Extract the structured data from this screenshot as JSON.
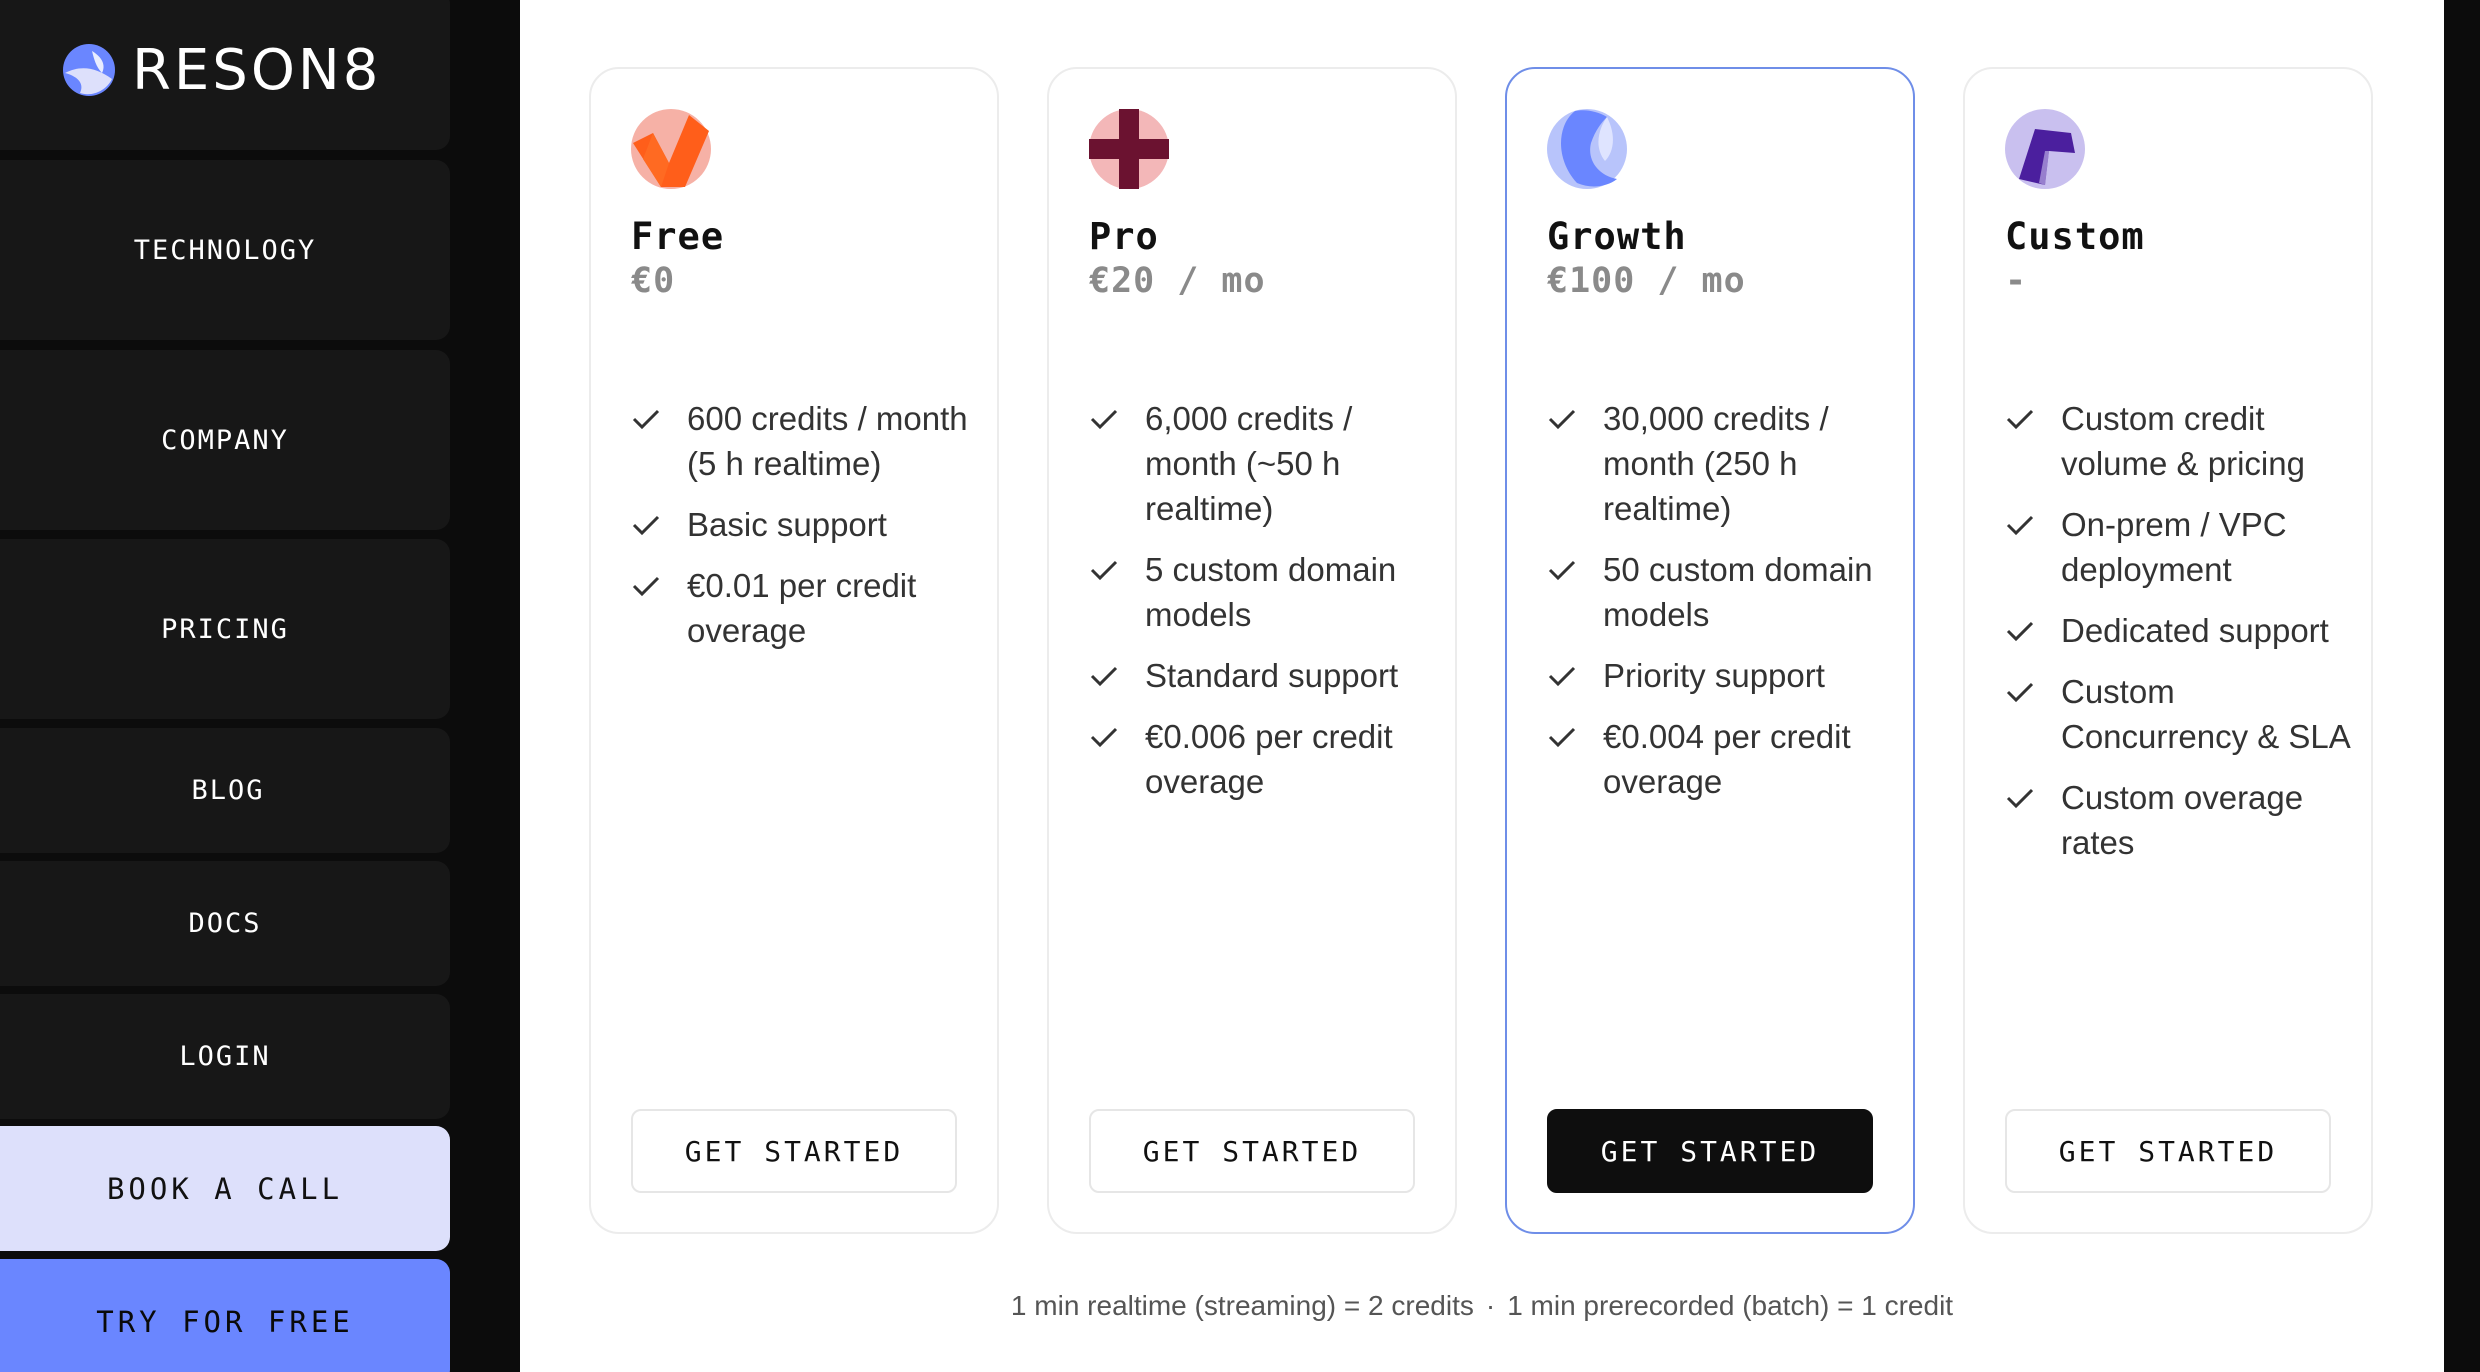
{
  "brand": {
    "name": "RESON8"
  },
  "nav": {
    "technology": "TECHNOLOGY",
    "company": "COMPANY",
    "pricing": "PRICING",
    "blog": "BLOG",
    "docs": "DOCS",
    "login": "LOGIN"
  },
  "cta": {
    "book_call": "BOOK A CALL",
    "try_free": "TRY FOR FREE"
  },
  "colors": {
    "accent": "#6a86ff",
    "accent_light": "#dde0fb",
    "highlight_border": "#6f8ee8"
  },
  "plans": [
    {
      "name": "Free",
      "price": "€0",
      "icon": "orange-check-logo-icon",
      "features": [
        "600 credits / month (5 h realtime)",
        "Basic support",
        "€0.01 per credit overage"
      ],
      "button": "GET STARTED",
      "highlighted": false
    },
    {
      "name": "Pro",
      "price": "€20 / mo",
      "icon": "maroon-cross-logo-icon",
      "features": [
        "6,000 credits / month (~50 h realtime)",
        "5 custom domain models",
        "Standard support",
        "€0.006 per credit overage"
      ],
      "button": "GET STARTED",
      "highlighted": false
    },
    {
      "name": "Growth",
      "price": "€100 / mo",
      "icon": "blue-crescent-logo-icon",
      "features": [
        "30,000 credits / month (250 h realtime)",
        "50 custom domain models",
        "Priority support",
        "€0.004 per credit overage"
      ],
      "button": "GET STARTED",
      "highlighted": true
    },
    {
      "name": "Custom",
      "price": "-",
      "icon": "purple-shape-logo-icon",
      "features": [
        "Custom credit volume & pricing",
        "On-prem / VPC deployment",
        "Dedicated support",
        "Custom Concurrency & SLA",
        "Custom overage rates"
      ],
      "button": "GET STARTED",
      "highlighted": false
    }
  ],
  "footnote": {
    "realtime": "1 min realtime (streaming)  = 2 credits",
    "separator": "·",
    "batch": "1 min prerecorded (batch) = 1 credit"
  }
}
